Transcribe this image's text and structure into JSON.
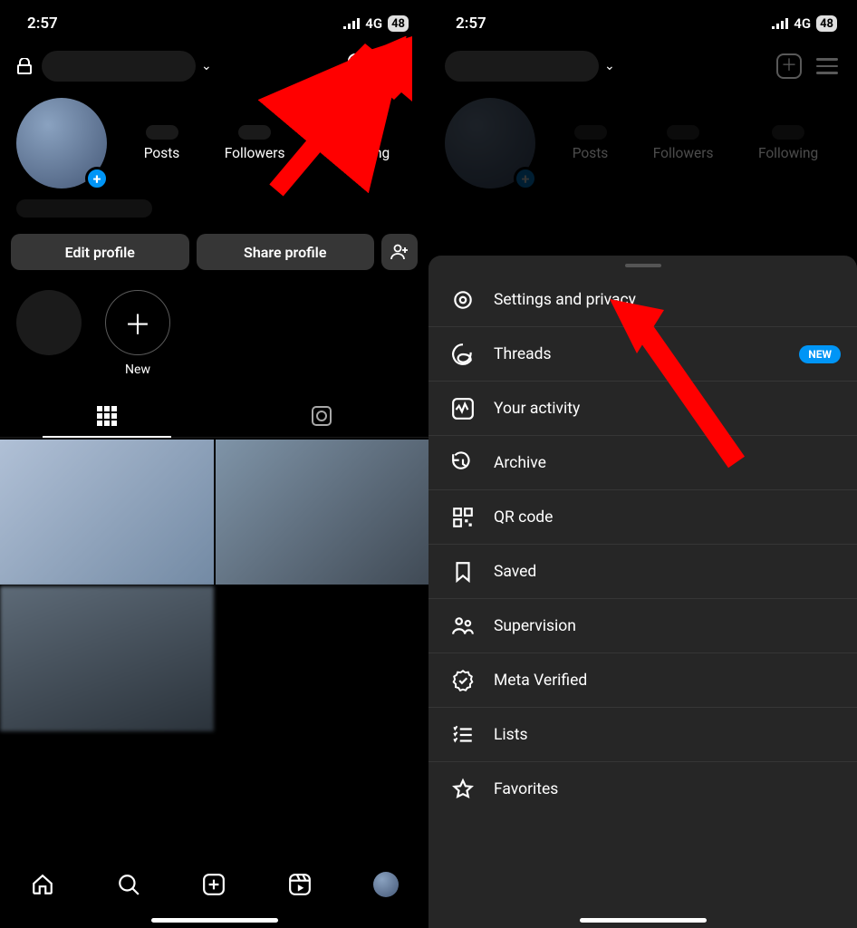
{
  "statusbar": {
    "time": "2:57",
    "network": "4G",
    "battery": "48"
  },
  "profile": {
    "stats": {
      "posts_label": "Posts",
      "followers_label": "Followers",
      "following_label": "Following"
    },
    "edit_label": "Edit profile",
    "share_label": "Share profile"
  },
  "highlights": {
    "new_label": "New"
  },
  "menu": {
    "settings": "Settings and privacy",
    "threads": "Threads",
    "activity": "Your activity",
    "archive": "Archive",
    "qr": "QR code",
    "saved": "Saved",
    "supervision": "Supervision",
    "verified": "Meta Verified",
    "lists": "Lists",
    "favorites": "Favorites",
    "new_badge": "NEW"
  },
  "icons": {
    "plus": "＋",
    "add_story": "+",
    "add_person": "+👤",
    "new_highlight": "＋"
  }
}
